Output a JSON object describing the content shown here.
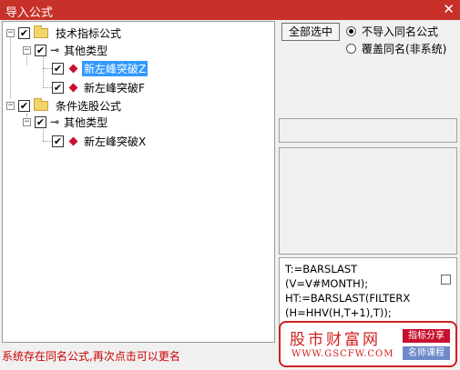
{
  "window": {
    "title": "导入公式",
    "close": "✕"
  },
  "tree": {
    "nodes": [
      {
        "label": "技术指标公式",
        "expander": "−",
        "checked": "✔"
      },
      {
        "label": "其他类型",
        "expander": "−",
        "checked": "✔"
      },
      {
        "label": "新左峰突破Z",
        "checked": "✔",
        "selected": true
      },
      {
        "label": "新左峰突破F",
        "checked": "✔"
      },
      {
        "label": "条件选股公式",
        "expander": "−",
        "checked": "✔"
      },
      {
        "label": "其他类型",
        "expander": "−",
        "checked": "✔"
      },
      {
        "label": "新左峰突破X",
        "checked": "✔"
      }
    ]
  },
  "actions": {
    "select_all": "全部选中",
    "options": [
      {
        "label": "不导入同名公式",
        "selected": true
      },
      {
        "label": "覆盖同名(非系统)",
        "selected": false
      }
    ]
  },
  "code": {
    "lines": [
      "T:=BARSLAST",
      "(V=V#MONTH);",
      "HT:=BARSLAST(FILTERX",
      "(H=HHV(H,T+1),T));"
    ]
  },
  "status": "系统存在同名公式,再次点击可以更名",
  "watermark": {
    "brand": "股市财富网",
    "url": "WWW.GSCFW.COM",
    "tag1": "指标分享",
    "tag2": "名师课程"
  }
}
